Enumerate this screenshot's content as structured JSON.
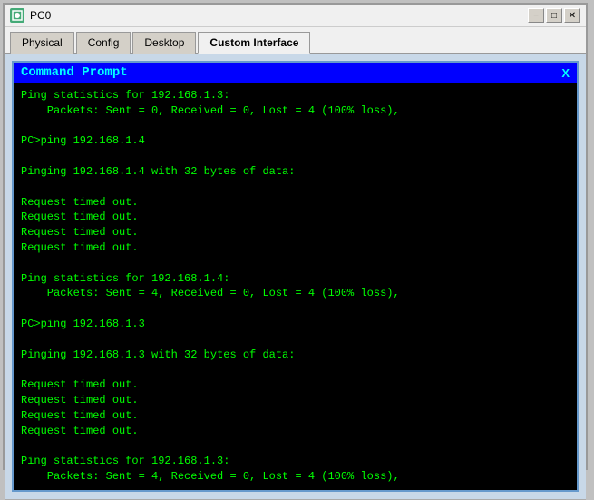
{
  "window": {
    "title": "PC0",
    "minimize_label": "−",
    "maximize_label": "□",
    "close_label": "✕"
  },
  "tabs": [
    {
      "id": "physical",
      "label": "Physical",
      "active": false
    },
    {
      "id": "config",
      "label": "Config",
      "active": false
    },
    {
      "id": "desktop",
      "label": "Desktop",
      "active": false
    },
    {
      "id": "custom-interface",
      "label": "Custom Interface",
      "active": true
    }
  ],
  "terminal": {
    "header": "Command Prompt",
    "close_label": "X",
    "content": "Ping statistics for 192.168.1.3:\n    Packets: Sent = 0, Received = 0, Lost = 4 (100% loss),\n\nPC>ping 192.168.1.4\n\nPinging 192.168.1.4 with 32 bytes of data:\n\nRequest timed out.\nRequest timed out.\nRequest timed out.\nRequest timed out.\n\nPing statistics for 192.168.1.4:\n    Packets: Sent = 4, Received = 0, Lost = 4 (100% loss),\n\nPC>ping 192.168.1.3\n\nPinging 192.168.1.3 with 32 bytes of data:\n\nRequest timed out.\nRequest timed out.\nRequest timed out.\nRequest timed out.\n\nPing statistics for 192.168.1.3:\n    Packets: Sent = 4, Received = 0, Lost = 4 (100% loss),"
  }
}
